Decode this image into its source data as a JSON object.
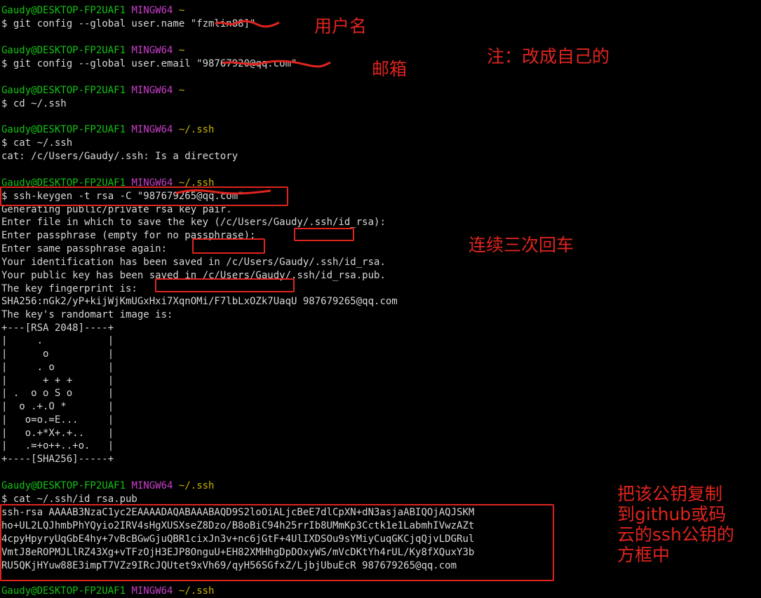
{
  "blocks": [
    {
      "prompt": {
        "user": "Gaudy@DESKTOP-FP2UAF1",
        "system": "MINGW64",
        "path": "~"
      },
      "command": "$ git config --global user.name \"fzmlin88]\"",
      "output": []
    },
    {
      "prompt": {
        "user": "Gaudy@DESKTOP-FP2UAF1",
        "system": "MINGW64",
        "path": "~"
      },
      "command": "$ git config --global user.email \"98767920@qq.com\"",
      "output": []
    },
    {
      "prompt": {
        "user": "Gaudy@DESKTOP-FP2UAF1",
        "system": "MINGW64",
        "path": "~"
      },
      "command": "$ cd ~/.ssh",
      "output": []
    },
    {
      "prompt": {
        "user": "Gaudy@DESKTOP-FP2UAF1",
        "system": "MINGW64",
        "path": "~/.ssh"
      },
      "command": "$ cat ~/.ssh",
      "output": [
        "cat: /c/Users/Gaudy/.ssh: Is a directory"
      ]
    },
    {
      "prompt": {
        "user": "Gaudy@DESKTOP-FP2UAF1",
        "system": "MINGW64",
        "path": "~/.ssh"
      },
      "command": "$ ssh-keygen -t rsa -C \"987679265@qq.com\"",
      "output": [
        "Generating public/private rsa key pair.",
        "Enter file in which to save the key (/c/Users/Gaudy/.ssh/id_rsa):",
        "Enter passphrase (empty for no passphrase):",
        "Enter same passphrase again:",
        "Your identification has been saved in /c/Users/Gaudy/.ssh/id_rsa.",
        "Your public key has been saved in /c/Users/Gaudy/.ssh/id_rsa.pub.",
        "The key fingerprint is:",
        "SHA256:nGk2/yP+kijWjKmUGxHxi7XqnOMi/F7lbLxOZk7UaqU 987679265@qq.com",
        "The key's randomart image is:",
        "+---[RSA 2048]----+",
        "|     .           |",
        "|      o          |",
        "|     . o         |",
        "|      + + +      |",
        "| .  o o S o      |",
        "|  o .+.O *       |",
        "|   o=o.=E...     |",
        "|   o.+*X+.+..    |",
        "|   .=+o++..+o.   |",
        "+----[SHA256]-----+"
      ]
    },
    {
      "prompt": {
        "user": "Gaudy@DESKTOP-FP2UAF1",
        "system": "MINGW64",
        "path": "~/.ssh"
      },
      "command": "$ cat ~/.ssh/id_rsa.pub",
      "output": [
        "ssh-rsa AAAAB3NzaC1yc2EAAAADAQABAAABAQD9S2loOiALjcBeE7dlCpXN+dN3asjaABIQOjAQJSKM",
        "ho+UL2LQJhmbPhYQyio2IRV4sHgXUSXseZ8Dzo/B8oBiC94h25rrIb8UMmKp3Cctk1e1LabmhIVwzAZt",
        "4cpyHpyryUqGbE4hy+7vBcBGwGjuQBR1cixJn3v+nc6jGtF+4UlIXDSOu9sYMiyCuqGKCjqQjvLDGRul",
        "VmtJ8eROPMJLlRZ43Xg+vTFzOjH3EJP8OnguU+EH82XMHhgDpDOxyWS/mVcDKtYh4rUL/Ky8fXQuxY3b",
        "RU5QKjHYuw88E3impT7VZz9IRcJQUtet9xVh69/qyH56SGfxZ/LjbjUbuEcR 987679265@qq.com"
      ]
    },
    {
      "prompt": {
        "user": "Gaudy@DESKTOP-FP2UAF1",
        "system": "MINGW64",
        "path": "~/.ssh"
      },
      "command": "",
      "output": []
    }
  ],
  "annotations": {
    "username_note": "用户名",
    "email_note": "邮箱",
    "change_note": "注：改成自己的",
    "enter_note": "连续三次回车",
    "copy_note": "把该公钥复制\n到github或码\n云的ssh公钥的\n方框中"
  },
  "colors": {
    "background": "#000000",
    "prompt_user": "#13c313",
    "prompt_system": "#c93fc9",
    "prompt_path": "#c8b400",
    "text": "#d8d8d8",
    "annotation": "#e0241e"
  }
}
